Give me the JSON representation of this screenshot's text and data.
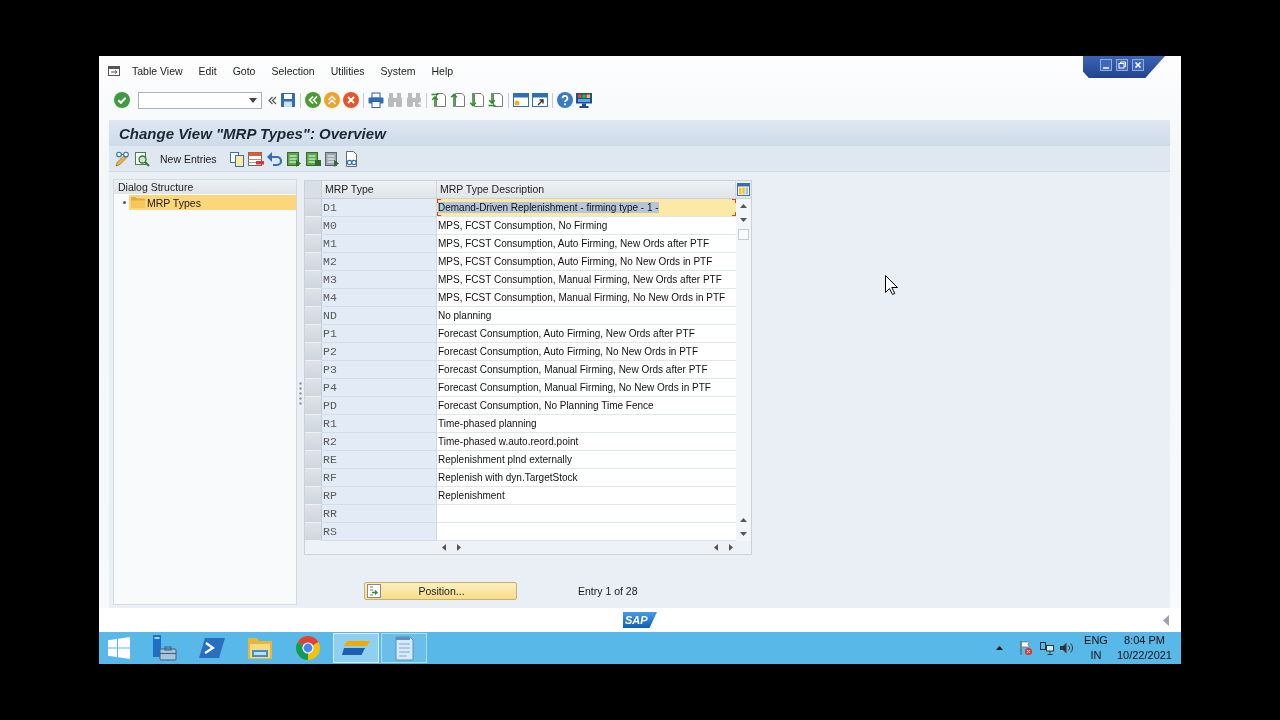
{
  "menu": [
    "Table View",
    "Edit",
    "Goto",
    "Selection",
    "Utilities",
    "System",
    "Help"
  ],
  "toolbar": [
    [
      {
        "kind": "enter",
        "disabled": false
      },
      {
        "kind": "command",
        "disabled": false
      },
      {
        "kind": "collapse",
        "disabled": false
      },
      {
        "kind": "save",
        "disabled": false
      }
    ],
    [
      {
        "kind": "back",
        "disabled": false
      },
      {
        "kind": "exit",
        "disabled": false
      },
      {
        "kind": "cancel",
        "disabled": false
      }
    ],
    [
      {
        "kind": "print",
        "disabled": false
      },
      {
        "kind": "find",
        "disabled": true
      },
      {
        "kind": "findnext",
        "disabled": true
      }
    ],
    [
      {
        "kind": "firstpage",
        "disabled": false
      },
      {
        "kind": "prevpage",
        "disabled": false
      },
      {
        "kind": "nextpage",
        "disabled": false
      },
      {
        "kind": "lastpage",
        "disabled": false
      }
    ],
    [
      {
        "kind": "session",
        "disabled": false
      },
      {
        "kind": "shortcut",
        "disabled": false
      }
    ],
    [
      {
        "kind": "help",
        "disabled": false
      },
      {
        "kind": "layout",
        "disabled": false
      }
    ]
  ],
  "title": "Change View \"MRP Types\": Overview",
  "app_toolbar": [
    {
      "kind": "toggle"
    },
    {
      "kind": "details"
    },
    {
      "kind": "text",
      "label": "New Entries"
    },
    {
      "kind": "copy"
    },
    {
      "kind": "delete"
    },
    {
      "kind": "undo"
    },
    {
      "kind": "selectall"
    },
    {
      "kind": "selectblock"
    },
    {
      "kind": "deselect"
    },
    {
      "kind": "printview"
    }
  ],
  "dialog_structure": {
    "title": "Dialog Structure",
    "items": [
      {
        "label": "MRP Types",
        "selected": true
      }
    ]
  },
  "table": {
    "columns": [
      "MRP Type",
      "MRP Type Description"
    ],
    "rows": [
      {
        "type": "D1",
        "description": "Demand-Driven Replenishment - firming type - 1 -",
        "selected": true
      },
      {
        "type": "M0",
        "description": "MPS, FCST Consumption, No Firming",
        "selected": false
      },
      {
        "type": "M1",
        "description": "MPS, FCST Consumption, Auto Firming, New Ords after PTF",
        "selected": false
      },
      {
        "type": "M2",
        "description": "MPS, FCST Consumption, Auto Firming, No New Ords in PTF",
        "selected": false
      },
      {
        "type": "M3",
        "description": "MPS, FCST Consumption, Manual Firming, New Ords after PTF",
        "selected": false
      },
      {
        "type": "M4",
        "description": "MPS, FCST Consumption, Manual Firming, No New Ords in PTF",
        "selected": false
      },
      {
        "type": "ND",
        "description": "No planning",
        "selected": false
      },
      {
        "type": "P1",
        "description": "Forecast Consumption, Auto Firming, New Ords after PTF",
        "selected": false
      },
      {
        "type": "P2",
        "description": "Forecast Consumption, Auto Firming, No New Ords in PTF",
        "selected": false
      },
      {
        "type": "P3",
        "description": "Forecast Consumption, Manual Firming, New Ords after PTF",
        "selected": false
      },
      {
        "type": "P4",
        "description": "Forecast Consumption, Manual Firming, No New Ords in PTF",
        "selected": false
      },
      {
        "type": "PD",
        "description": "Forecast Consumption, No Planning Time Fence",
        "selected": false
      },
      {
        "type": "R1",
        "description": "Time-phased planning",
        "selected": false
      },
      {
        "type": "R2",
        "description": "Time-phased w.auto.reord.point",
        "selected": false
      },
      {
        "type": "RE",
        "description": "Replenishment plnd externally",
        "selected": false
      },
      {
        "type": "RF",
        "description": "Replenish with dyn.TargetStock",
        "selected": false
      },
      {
        "type": "RP",
        "description": "Replenishment",
        "selected": false
      },
      {
        "type": "RR",
        "selected": false
      },
      {
        "type": "RS",
        "selected": false
      }
    ]
  },
  "position_button": "Position...",
  "entry_info": "Entry 1 of 28",
  "status_bar": {
    "logo": "SAP"
  },
  "taskbar": {
    "apps": [
      {
        "kind": "server",
        "running": false,
        "selected": false
      },
      {
        "kind": "shell",
        "running": false,
        "selected": false
      },
      {
        "kind": "files",
        "running": false,
        "selected": false
      },
      {
        "kind": "browser",
        "running": false,
        "selected": false
      },
      {
        "kind": "sapgui",
        "running": true,
        "selected": true
      },
      {
        "kind": "notepad",
        "running": true,
        "selected": false
      }
    ],
    "tray": {
      "language": "ENG",
      "region": "IN",
      "time": "8:04 PM",
      "date": "10/22/2021"
    }
  }
}
